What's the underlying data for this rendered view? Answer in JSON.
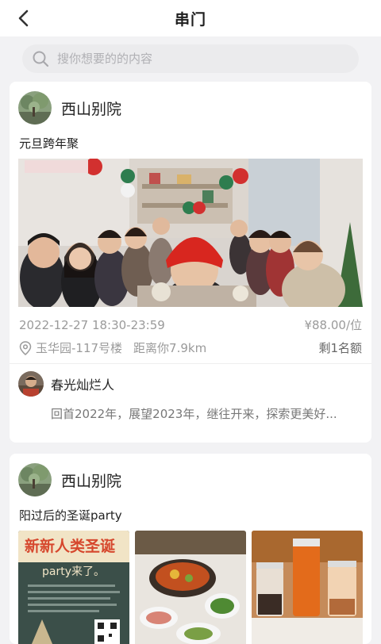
{
  "header": {
    "title": "串门",
    "back_icon": "chevron-left-icon"
  },
  "search": {
    "placeholder": "搜你想要的的内容",
    "value": "",
    "icon": "search-icon"
  },
  "posts": [
    {
      "host_name": "西山别院",
      "event_title": "元旦跨年聚",
      "datetime": "2022-12-27 18:30-23:59",
      "price": "¥88.00/位",
      "location": "玉华园-117号楼",
      "distance": "距离你7.9km",
      "spots_left": "剩1名额",
      "comment": {
        "user_name": "春光灿烂人",
        "text": "回首2022年，展望2023年，继往开来，探索更美好..."
      }
    },
    {
      "host_name": "西山别院",
      "event_title": "阳过后的圣诞party",
      "poster_text": "新新人类圣诞",
      "poster_subtext": "party来了。"
    }
  ],
  "colors": {
    "background": "#f2f2f4",
    "card": "#ffffff",
    "muted_text": "#9a9a9a",
    "search_bg": "#ebebed"
  }
}
